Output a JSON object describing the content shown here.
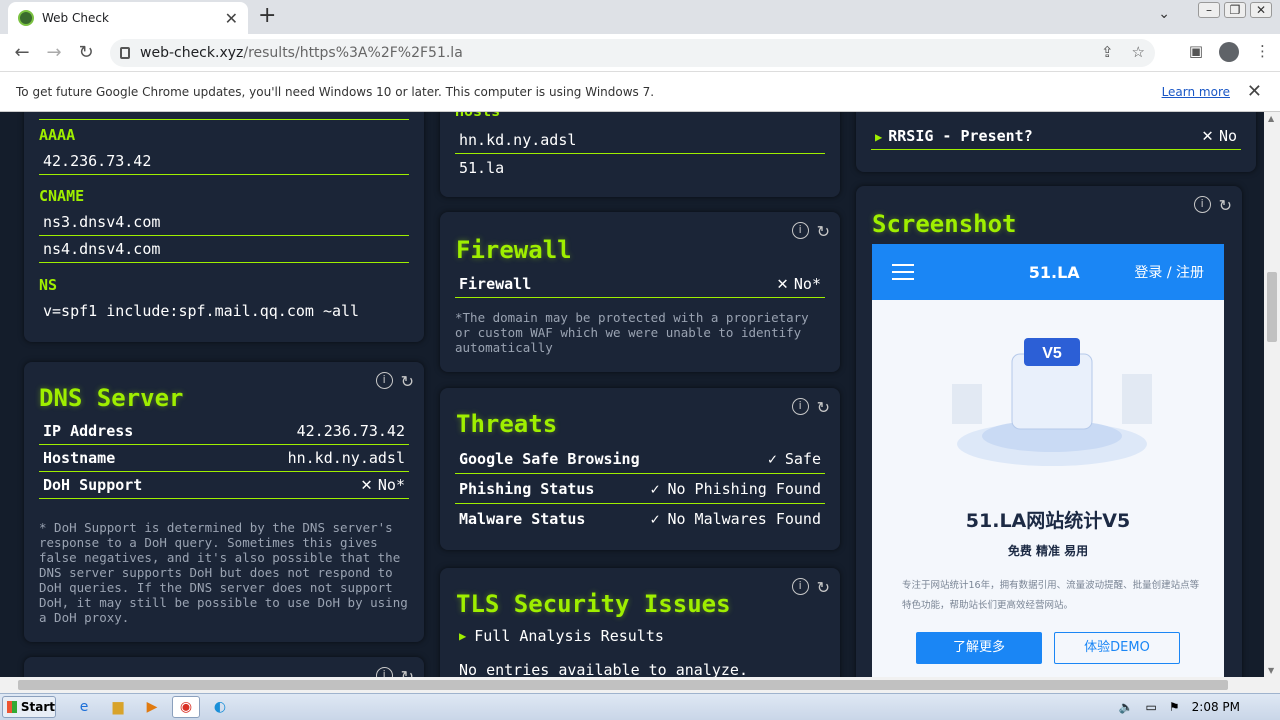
{
  "browser": {
    "tab_title": "Web Check",
    "url_host": "web-check.xyz",
    "url_path": "/results/https%3A%2F%2F51.la",
    "infobar_text": "To get future Google Chrome updates, you'll need Windows 10 or later. This computer is using Windows 7.",
    "infobar_link": "Learn more"
  },
  "dns_records": {
    "aaaa_label": "AAAA",
    "aaaa_value": "42.236.73.42",
    "cname_label": "CNAME",
    "cname_values": [
      "ns3.dnsv4.com",
      "ns4.dnsv4.com"
    ],
    "ns_label": "NS",
    "ns_value": "v=spf1 include:spf.mail.qq.com ~all"
  },
  "dns_server": {
    "title": "DNS Server",
    "rows": [
      {
        "key": "IP Address",
        "value": "42.236.73.42"
      },
      {
        "key": "Hostname",
        "value": "hn.kd.ny.adsl"
      },
      {
        "key": "DoH Support",
        "value": "No*"
      }
    ],
    "note": "* DoH Support is determined by the DNS server's response to a DoH query. Sometimes this gives false negatives, and it's also possible that the DNS server supports DoH but does not respond to DoH queries. If the DNS server does not support DoH, it may still be possible to use DoH by using a DoH proxy."
  },
  "hosts": {
    "label": "Hosts",
    "values": [
      "hn.kd.ny.adsl",
      "51.la"
    ]
  },
  "firewall": {
    "title": "Firewall",
    "row_key": "Firewall",
    "row_value": "No*",
    "note": "*The domain may be protected with a proprietary or custom WAF which we were unable to identify automatically"
  },
  "threats": {
    "title": "Threats",
    "rows": [
      {
        "key": "Google Safe Browsing",
        "value": "Safe"
      },
      {
        "key": "Phishing Status",
        "value": "No Phishing Found"
      },
      {
        "key": "Malware Status",
        "value": "No Malwares Found"
      }
    ]
  },
  "tls": {
    "title": "TLS Security Issues",
    "expander": "Full Analysis Results",
    "empty": "No entries available to analyze."
  },
  "dnssec": {
    "row_key": "RRSIG - Present?",
    "row_value": "No"
  },
  "screenshot": {
    "title": "Screenshot",
    "site_logo": "51.LA",
    "site_login": "登录 / 注册",
    "hero_badge": "V5",
    "hero_title": "51.LA网站统计V5",
    "hero_sub": "免费 精准 易用",
    "hero_desc": "专注于网站统计16年，拥有数据引用、流量波动提醒、批量创建站点等特色功能，帮助站长们更高效经营网站。",
    "btn_primary": "了解更多",
    "btn_secondary": "体验DEMO"
  },
  "taskbar": {
    "start": "Start",
    "clock": "2:08 PM"
  },
  "colors": {
    "accent": "#9fef00",
    "card_bg": "#1b2537",
    "page_bg": "#141d2b"
  }
}
